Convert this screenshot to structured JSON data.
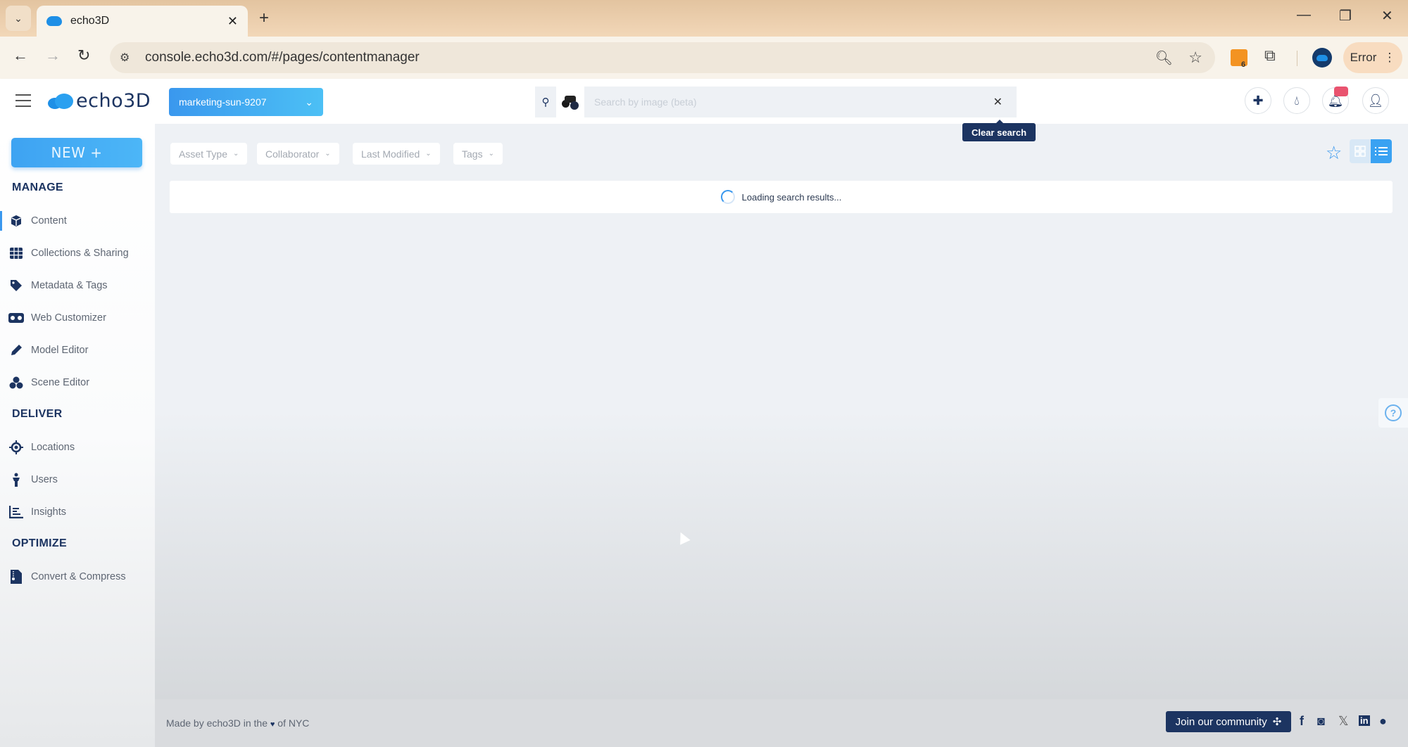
{
  "browser": {
    "tab_title": "echo3D",
    "url": "console.echo3d.com/#/pages/contentmanager",
    "extension_badge": "6",
    "profile_status": "Error"
  },
  "header": {
    "brand": "echo3D",
    "project": "marketing-sun-9207",
    "search_placeholder": "Search by image (beta)",
    "search_value": "",
    "clear_tooltip": "Clear search"
  },
  "sidebar": {
    "new_button": "NEW +",
    "sections": [
      {
        "title": "MANAGE",
        "items": [
          {
            "label": "Content",
            "icon": "cube-icon",
            "active": true
          },
          {
            "label": "Collections & Sharing",
            "icon": "grid-icon"
          },
          {
            "label": "Metadata & Tags",
            "icon": "tag-icon"
          },
          {
            "label": "Web Customizer",
            "icon": "vr-headset-icon"
          },
          {
            "label": "Model Editor",
            "icon": "pencil-icon"
          },
          {
            "label": "Scene Editor",
            "icon": "cubes-icon"
          }
        ]
      },
      {
        "title": "DELIVER",
        "items": [
          {
            "label": "Locations",
            "icon": "crosshair-icon"
          },
          {
            "label": "Users",
            "icon": "person-icon"
          },
          {
            "label": "Insights",
            "icon": "chart-icon"
          }
        ]
      },
      {
        "title": "OPTIMIZE",
        "items": [
          {
            "label": "Convert & Compress",
            "icon": "file-zip-icon"
          }
        ]
      }
    ]
  },
  "main": {
    "filters": [
      "Asset Type",
      "Collaborator",
      "Last Modified",
      "Tags"
    ],
    "loading_text": "Loading search results...",
    "view_mode": "list"
  },
  "footer": {
    "made_by_prefix": "Made by echo3D in the",
    "made_by_suffix": "of NYC",
    "community_button": "Join our community",
    "socials": [
      "facebook",
      "instagram",
      "x",
      "linkedin",
      "github"
    ]
  }
}
